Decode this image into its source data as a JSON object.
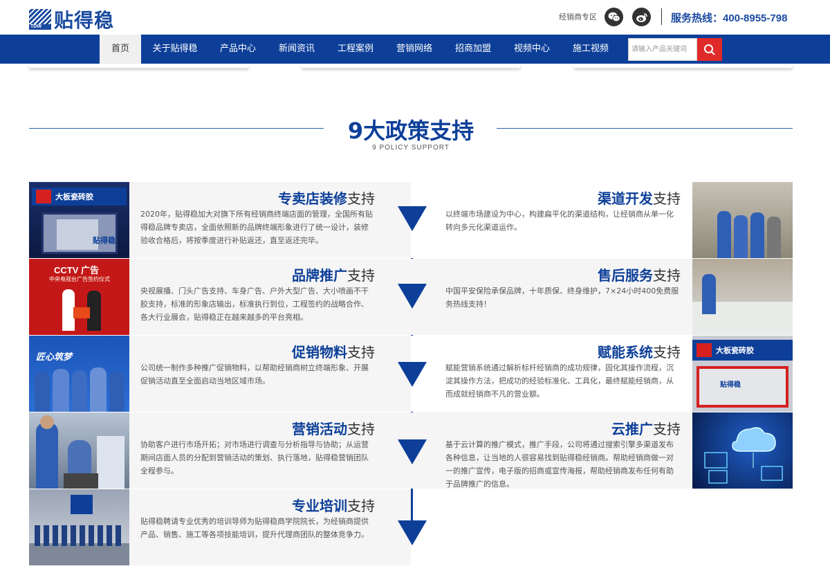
{
  "header": {
    "logo_text": "贴得稳",
    "logo_badge": "TDW",
    "dealer_zone": "经销商专区",
    "icons": [
      "wechat-icon",
      "weibo-icon"
    ],
    "hotline": "服务热线：400-8955-798"
  },
  "nav": {
    "items": [
      {
        "label": "首页",
        "active": true
      },
      {
        "label": "关于贴得稳"
      },
      {
        "label": "产品中心"
      },
      {
        "label": "新闻资讯"
      },
      {
        "label": "工程案例"
      },
      {
        "label": "营销网络"
      },
      {
        "label": "招商加盟"
      },
      {
        "label": "视频中心"
      },
      {
        "label": "施工视频"
      }
    ],
    "search_placeholder": "请输入产品关键词"
  },
  "section": {
    "title": "9大政策支持",
    "subtitle": "9 POLICY SUPPORT"
  },
  "policies_left": [
    {
      "key": "专卖店装修",
      "suffix": "支持",
      "desc": "2020年，贴得稳加大对旗下所有经销商终端店面的管理，全国所有贴得稳品牌专卖店，全面依照新的品牌终端形象进行了统一设计，装修验收合格后，将按季度进行补贴返还，直至返还完毕。",
      "thumb_text": "大板瓷砖胶",
      "thumb_brand": "贴得稳"
    },
    {
      "key": "品牌推广",
      "suffix": "支持",
      "desc": "央视展播、门头广告支持、车身广告、户外大型广告、大小喷画不干胶支持，标准的形象店输出，标准执行到位，工程签约的战略合作、各大行业展会，贴得稳正在越来越多的平台亮相。",
      "thumb_text": "CCTV 广告",
      "thumb_sub": "中央电视台广告签约仪式"
    },
    {
      "key": "促销物料",
      "suffix": "支持",
      "desc": "公司统一制作多种推广促销物料，以帮助经销商树立终端形象、开展促销活动直至全面启动当地区域市场。",
      "thumb_text": "匠心筑梦"
    },
    {
      "key": "营销活动",
      "suffix": "支持",
      "desc": "协助客户进行市场开拓；对市场进行调查与分析指导与协助；从运营期间店面人员的分配到营销活动的策划、执行落地，贴得稳营销团队全程参与。"
    },
    {
      "key": "专业培训",
      "suffix": "支持",
      "desc": "贴得稳聘请专业优秀的培训导师为贴得稳商学院院长，为经销商提供产品、销售、施工等各项技能培训，提升代理商团队的整体竞争力。"
    }
  ],
  "policies_right": [
    {
      "key": "渠道开发",
      "suffix": "支持",
      "desc": "以终端市场建设为中心，构建扁平化的渠道结构，让经销商从单一化转向多元化渠道运作。"
    },
    {
      "key": "售后服务",
      "suffix": "支持",
      "desc": "中国平安保险承保品牌，十年质保、终身维护，7×24小时400免费服务热线支持！"
    },
    {
      "key": "赋能系统",
      "suffix": "支持",
      "desc": "赋能营销系统通过解析标杆经销商的成功规律，固化其操作流程，沉淀其操作方法，把成功的经验标准化、工具化，最终赋能经销商，从而成就经销商不凡的营业额。",
      "thumb_text": "大板瓷砖胶",
      "thumb_brand": "贴得稳"
    },
    {
      "key": "云推广",
      "suffix": "支持",
      "desc": "基于云计算的推广模式，推广手段，公司将通过搜索引擎多渠道发布各种信息，让当地的人很容易找到贴得稳经销商。帮助经销商做一对一的推广宣传，电子版的招商或宣传海报，帮助经销商发布任何有助于品牌推广的信息。"
    }
  ],
  "colors": {
    "brand_blue": "#0d3f99",
    "search_red": "#e02a2a",
    "row_gray": "#f5f5f5"
  }
}
